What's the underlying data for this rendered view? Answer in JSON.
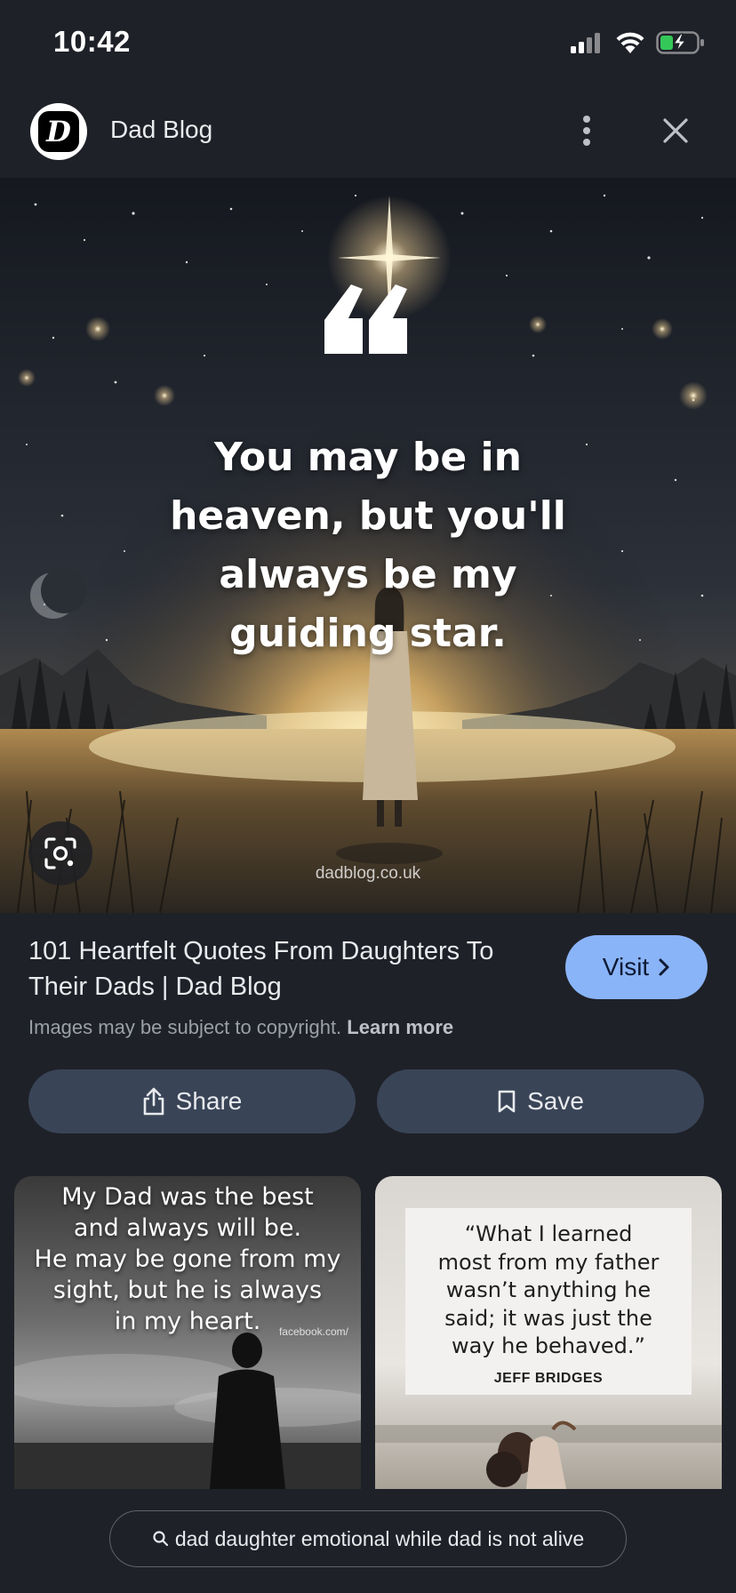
{
  "status_bar": {
    "time": "10:42"
  },
  "header": {
    "logo_letter": "D",
    "site_name": "Dad Blog"
  },
  "hero": {
    "quote": "You may be in\nheaven, but you'll\nalways be my\nguiding star.",
    "watermark": "dadblog.co.uk"
  },
  "result": {
    "title": "101 Heartfelt Quotes From Daughters To Their Dads | Dad Blog",
    "visit_label": "Visit",
    "copyright_text": "Images may be subject to copyright.",
    "learn_more_label": "Learn more"
  },
  "actions": {
    "share_label": "Share",
    "save_label": "Save"
  },
  "related": [
    {
      "quote": "My Dad was the best\nand always will be.\nHe may be gone from my\nsight, but he is always\nin my heart.",
      "source": "facebook.com/"
    },
    {
      "quote": "“What I learned\nmost from my father\nwasn’t anything he\nsaid; it was just the\nway he behaved.”",
      "author": "JEFF BRIDGES"
    }
  ],
  "search": {
    "query": "dad daughter emotional while dad is not alive"
  },
  "colors": {
    "background": "#1f2128",
    "visit_button": "#8ab4f8",
    "action_button": "#394457",
    "battery_green": "#34c759"
  },
  "icons": [
    "signal-icon",
    "wifi-icon",
    "battery-charging-icon",
    "more-vert-icon",
    "close-icon",
    "lens-icon",
    "chevron-right-icon",
    "share-icon",
    "bookmark-icon",
    "search-icon"
  ]
}
